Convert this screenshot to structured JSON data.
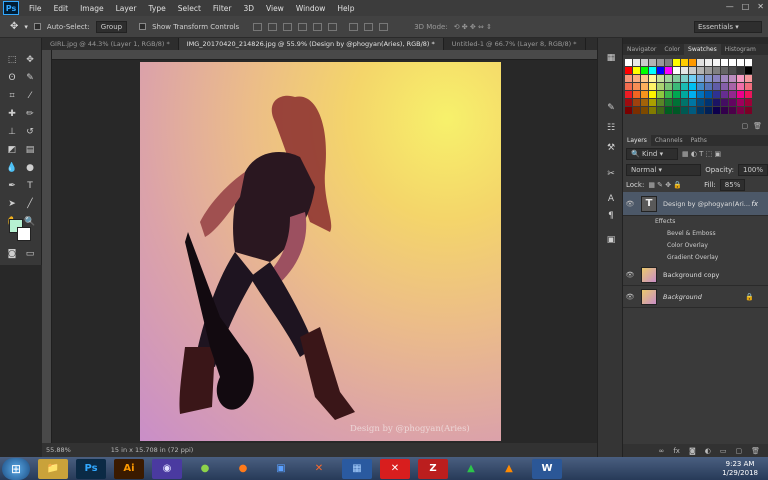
{
  "menu": [
    "File",
    "Edit",
    "Image",
    "Layer",
    "Type",
    "Select",
    "Filter",
    "3D",
    "View",
    "Window",
    "Help"
  ],
  "app_logo": "Ps",
  "window_controls": [
    "—",
    "□",
    "✕"
  ],
  "options": {
    "auto_select_label": "Auto-Select:",
    "auto_select_value": "Group",
    "show_transform_label": "Show Transform Controls",
    "mode_3d_label": "3D Mode:",
    "workspace": "Essentials"
  },
  "tabs": [
    {
      "label": "GIRL.jpg @ 44.3% (Layer 1, RGB/8) *",
      "active": false
    },
    {
      "label": "IMG_20170420_214826.jpg @ 55.9% (Design by @phogyan(Aries), RGB/8) *",
      "active": true
    },
    {
      "label": "Untitled-1 @ 66.7% (Layer 8, RGB/8) *",
      "active": false
    }
  ],
  "canvas": {
    "watermark": "Design by @phogyan(Aries)"
  },
  "status": {
    "zoom": "55.88%",
    "doc_info": "15 in x 15.708 in (72 ppi)"
  },
  "panels": {
    "top_tabs": [
      "Navigator",
      "Color",
      "Swatches",
      "Histogram"
    ],
    "active_top": "Swatches",
    "layer_tabs": [
      "Layers",
      "Channels",
      "Paths"
    ],
    "kind_label": "Kind",
    "blend_mode": "Normal",
    "opacity_label": "Opacity:",
    "opacity_value": "100%",
    "lock_label": "Lock:",
    "fill_label": "Fill:",
    "fill_value": "85%",
    "layers": [
      {
        "name": "Design by @phogyan(Ari...",
        "type": "text"
      },
      {
        "name": "Background copy",
        "type": "image"
      },
      {
        "name": "Background",
        "type": "image"
      }
    ],
    "effects": [
      "Effects",
      "Bevel & Emboss",
      "Color Overlay",
      "Gradient Overlay"
    ],
    "fx_badge": "fx"
  },
  "swatch_colors": [
    "#ffffff",
    "#e8e8e8",
    "#cccccc",
    "#b3b3b3",
    "#999999",
    "#808080",
    "#ffff00",
    "#ffcc00",
    "#ff9900",
    "#e0e0e0",
    "#ededed",
    "#f5f5f5",
    "#ffffff",
    "#ffffff",
    "#ffffff",
    "#ffffff",
    "#ff0000",
    "#ffff00",
    "#00ff00",
    "#00ffff",
    "#0000ff",
    "#ff00ff",
    "#ffffff",
    "#e6e6e6",
    "#cccccc",
    "#b3b3b3",
    "#999999",
    "#808080",
    "#666666",
    "#4d4d4d",
    "#333333",
    "#000000",
    "#f7977a",
    "#f9ad81",
    "#fdc68a",
    "#fff79a",
    "#c4df9b",
    "#a2d39c",
    "#82ca9d",
    "#7bcdc8",
    "#6ecff6",
    "#7ea7d8",
    "#8493ca",
    "#8882be",
    "#a187be",
    "#bc8dbf",
    "#f49ac2",
    "#f6989d",
    "#f26c4f",
    "#f68e55",
    "#fbaf5c",
    "#fff467",
    "#acd372",
    "#7cc576",
    "#3bb878",
    "#1abbb4",
    "#00bff3",
    "#438ccb",
    "#5574b9",
    "#605ca8",
    "#855fa8",
    "#a763a8",
    "#f06ea9",
    "#f26d7d",
    "#ed1c24",
    "#f26522",
    "#f7941d",
    "#fff200",
    "#8dc73f",
    "#39b54a",
    "#00a651",
    "#00a99d",
    "#00aeef",
    "#0072bc",
    "#0054a6",
    "#2e3192",
    "#662d91",
    "#92278f",
    "#ec008c",
    "#ed145b",
    "#9e0b0f",
    "#a0410d",
    "#a36209",
    "#aba000",
    "#598527",
    "#1a7b30",
    "#007236",
    "#00746b",
    "#0076a3",
    "#004b80",
    "#003471",
    "#1b1464",
    "#440e62",
    "#630460",
    "#9e005d",
    "#9e0039",
    "#790000",
    "#7b2e00",
    "#7d4900",
    "#827b00",
    "#406618",
    "#005e20",
    "#005826",
    "#005952",
    "#005b7f",
    "#003663",
    "#002157",
    "#0d004c",
    "#32004b",
    "#4b0049",
    "#7b0046",
    "#7a0026"
  ],
  "taskbar": [
    {
      "name": "explorer",
      "glyph": "📁",
      "bg": "#c9a23a",
      "fg": "#3b2a00"
    },
    {
      "name": "photoshop",
      "glyph": "Ps",
      "bg": "#0b2a45",
      "fg": "#31a8ff"
    },
    {
      "name": "illustrator",
      "glyph": "Ai",
      "bg": "#3a1a00",
      "fg": "#ff9a00"
    },
    {
      "name": "media-player",
      "glyph": "◉",
      "bg": "#4a3aa0",
      "fg": "#e0e0ff"
    },
    {
      "name": "android",
      "glyph": "●",
      "bg": "transparent",
      "fg": "#8dd34a"
    },
    {
      "name": "firefox",
      "glyph": "●",
      "bg": "transparent",
      "fg": "#ff7a1a"
    },
    {
      "name": "virtualbox",
      "glyph": "▣",
      "bg": "transparent",
      "fg": "#5aa0ff"
    },
    {
      "name": "xampp",
      "glyph": "✕",
      "bg": "transparent",
      "fg": "#ff6a2a"
    },
    {
      "name": "network-tool",
      "glyph": "▦",
      "bg": "#2a5aa0",
      "fg": "#a8d0ff"
    },
    {
      "name": "close-app",
      "glyph": "✕",
      "bg": "#d81e1e",
      "fg": "#ffffff"
    },
    {
      "name": "filezilla",
      "glyph": "Z",
      "bg": "#bb1e1e",
      "fg": "#ffffff"
    },
    {
      "name": "green-app",
      "glyph": "▲",
      "bg": "transparent",
      "fg": "#2cc44a"
    },
    {
      "name": "vlc",
      "glyph": "▲",
      "bg": "transparent",
      "fg": "#ff8a00"
    },
    {
      "name": "word",
      "glyph": "W",
      "bg": "#2b5797",
      "fg": "#ffffff"
    }
  ],
  "clock": {
    "time": "9:23 AM",
    "date": "1/29/2018"
  }
}
